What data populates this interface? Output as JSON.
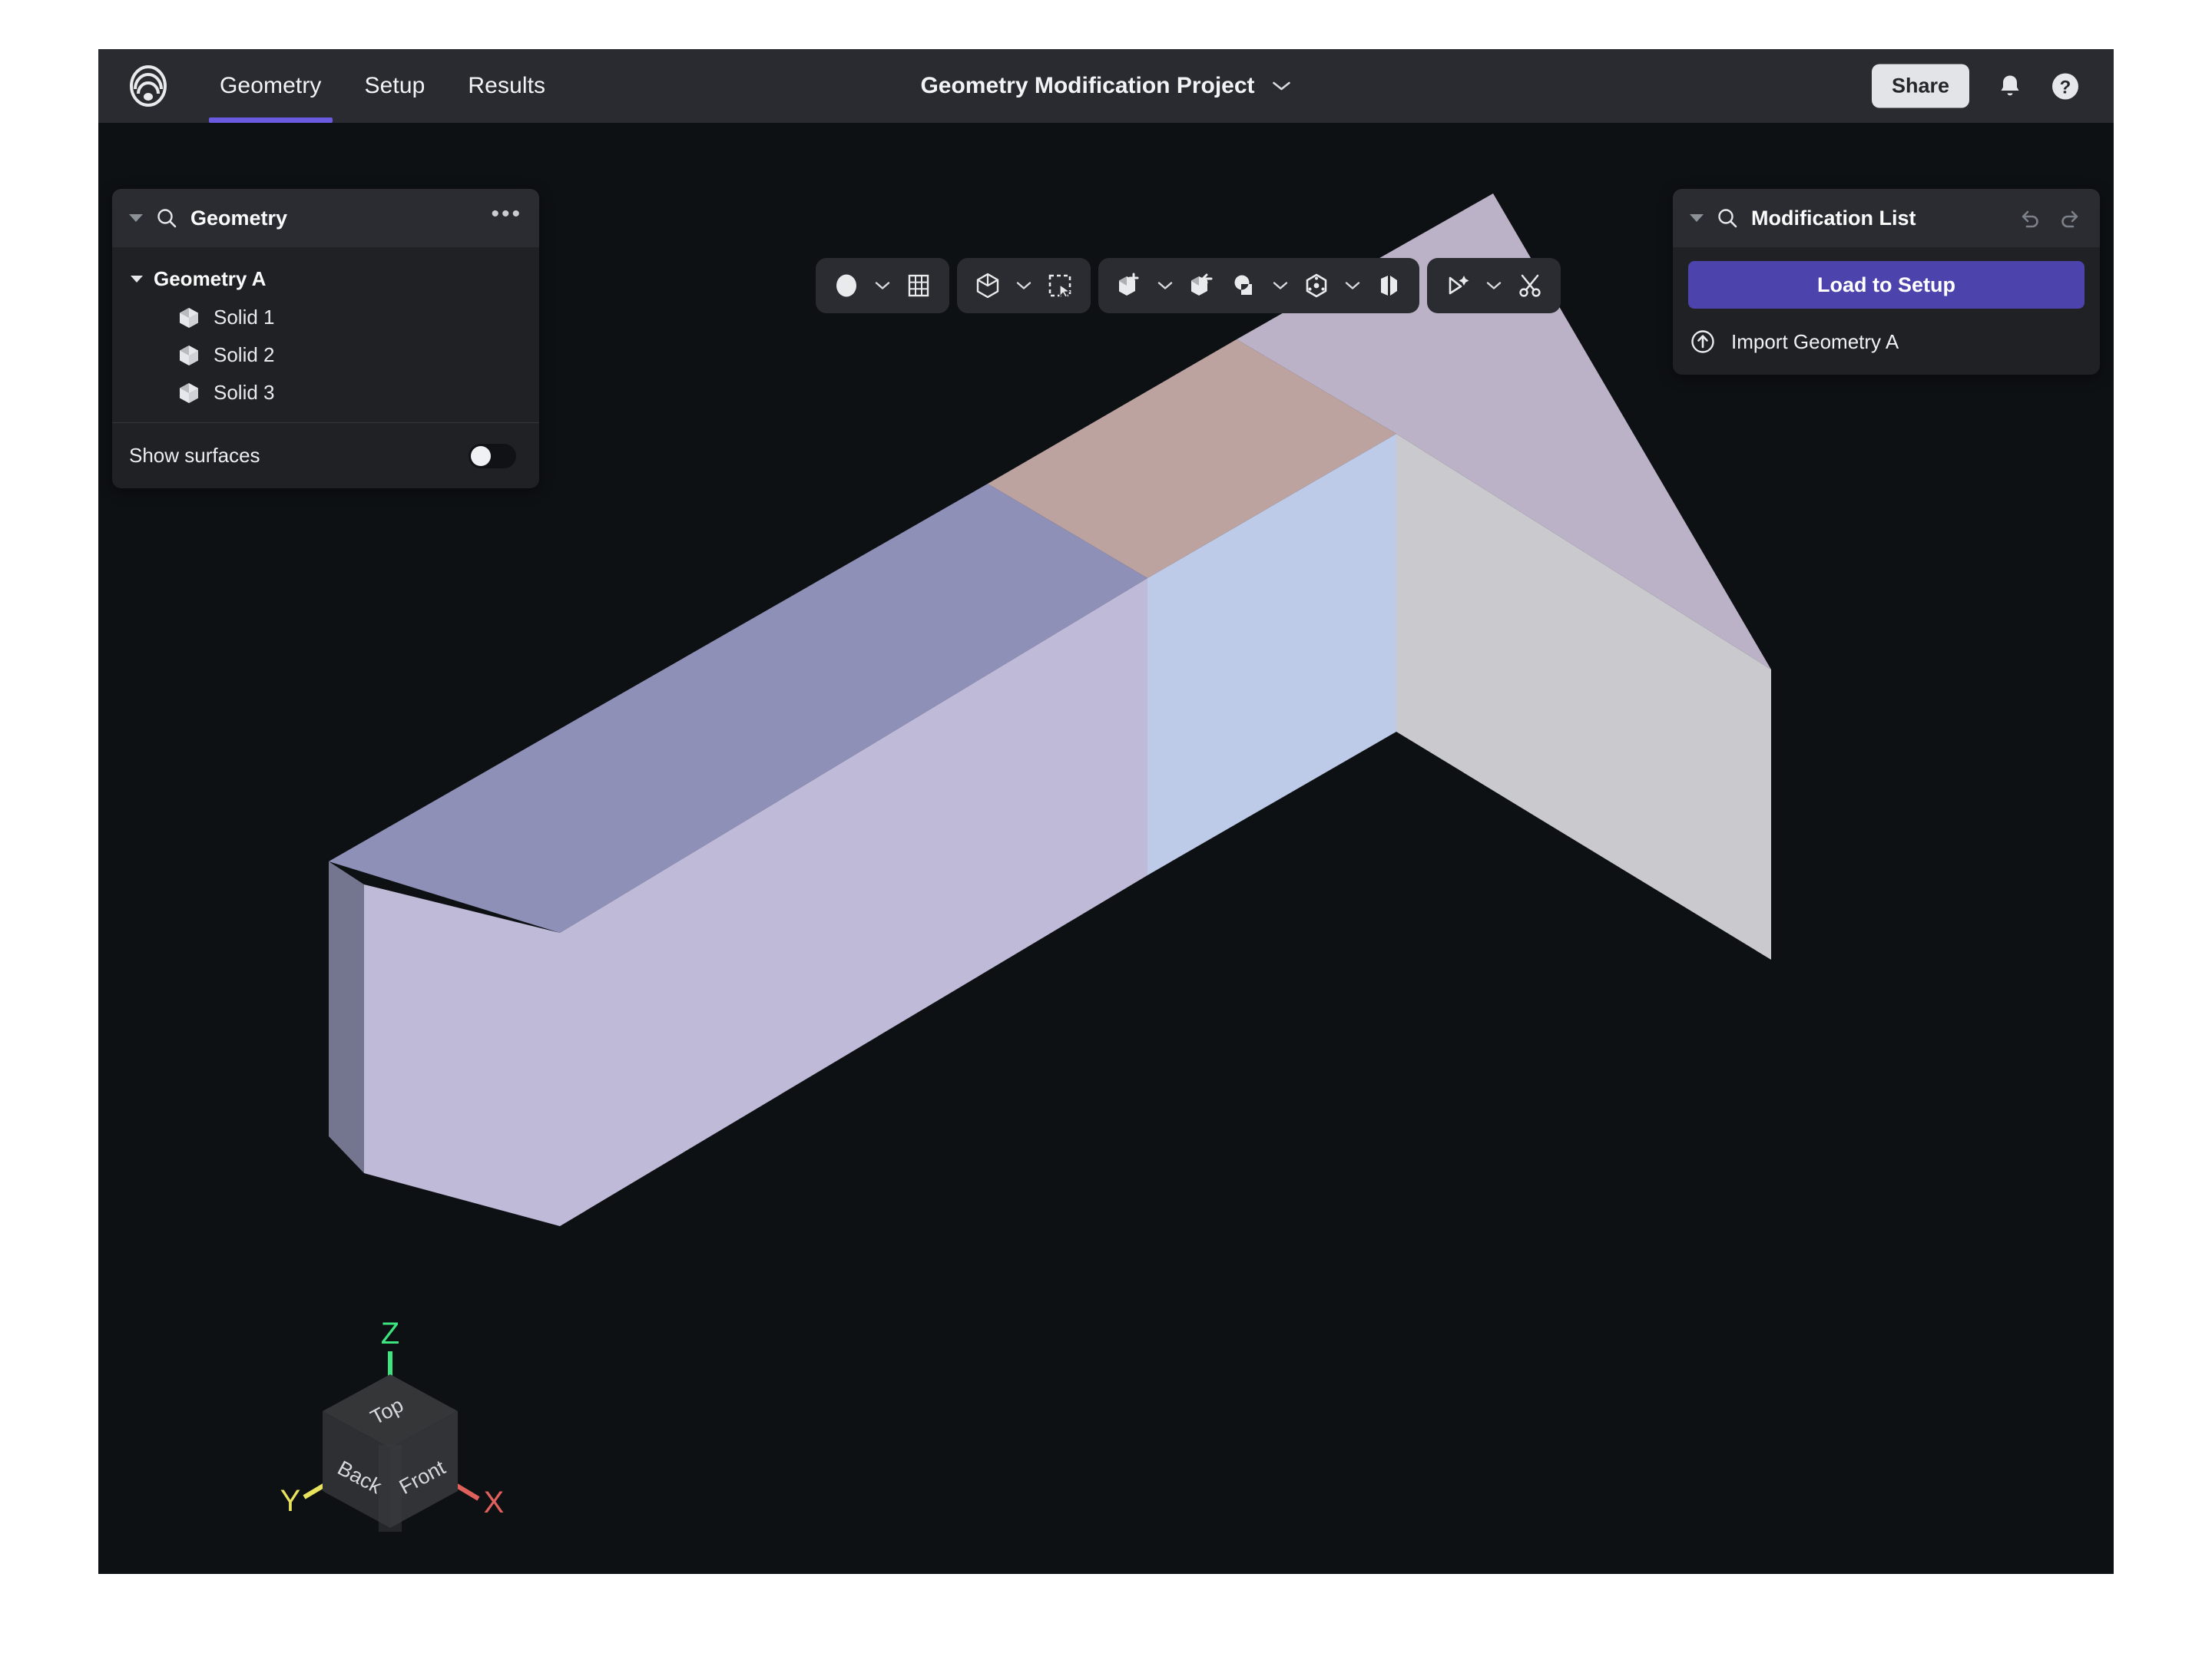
{
  "header": {
    "logo_icon": "concentric-arcs-logo",
    "tabs": [
      {
        "label": "Geometry",
        "active": true
      },
      {
        "label": "Setup",
        "active": false
      },
      {
        "label": "Results",
        "active": false
      }
    ],
    "project_title": "Geometry Modification Project",
    "title_caret_icon": "chevron-down-icon",
    "share_label": "Share",
    "notifications_icon": "bell-icon",
    "help_icon": "question-mark-icon"
  },
  "left_panel": {
    "collapse_icon": "triangle-down-icon",
    "search_icon": "search-icon",
    "title": "Geometry",
    "menu_icon": "ellipsis-icon",
    "tree": {
      "root_label": "Geometry A",
      "root_expanded": true,
      "items": [
        {
          "label": "Solid 1",
          "icon": "cube-icon"
        },
        {
          "label": "Solid 2",
          "icon": "cube-icon"
        },
        {
          "label": "Solid 3",
          "icon": "cube-icon"
        }
      ]
    },
    "footer": {
      "label": "Show surfaces",
      "toggle_on": false
    }
  },
  "toolbar": {
    "groups": [
      {
        "name": "display-group",
        "buttons": [
          {
            "icon": "filled-circle-icon",
            "name": "render-mode-button",
            "caret": true
          },
          {
            "icon": "grid-icon",
            "name": "grid-toggle-button",
            "caret": false
          }
        ]
      },
      {
        "name": "selection-group",
        "buttons": [
          {
            "icon": "cube-outline-icon",
            "name": "select-solid-button",
            "caret": true
          },
          {
            "icon": "marquee-select-icon",
            "name": "box-select-button",
            "caret": false
          }
        ]
      },
      {
        "name": "modify-group",
        "buttons": [
          {
            "icon": "cube-plus-icon",
            "name": "add-solid-button",
            "caret": true
          },
          {
            "icon": "cube-minus-icon",
            "name": "subtract-solid-button",
            "caret": false
          },
          {
            "icon": "boolean-intersect-icon",
            "name": "boolean-button",
            "caret": true
          },
          {
            "icon": "hexagon-origin-icon",
            "name": "transform-button",
            "caret": true
          },
          {
            "icon": "mirror-fold-icon",
            "name": "mirror-button",
            "caret": false
          }
        ]
      },
      {
        "name": "tools-group",
        "buttons": [
          {
            "icon": "magic-wand-icon",
            "name": "auto-detect-button",
            "caret": true
          },
          {
            "icon": "scissors-icon",
            "name": "cut-button",
            "caret": false
          }
        ]
      }
    ]
  },
  "right_panel": {
    "collapse_icon": "triangle-down-icon",
    "search_icon": "search-icon",
    "title": "Modification List",
    "undo_icon": "undo-arrow-icon",
    "redo_icon": "redo-arrow-icon",
    "primary_button_label": "Load to Setup",
    "primary_button_color": "#4c43ac",
    "items": [
      {
        "label": "Import Geometry A",
        "icon": "upload-circle-icon"
      }
    ]
  },
  "viewport": {
    "background": "#0e1114",
    "cursor_icon": "pointing-hand-cursor",
    "view_cube": {
      "faces": [
        "Top",
        "Back",
        "Front"
      ],
      "axes": [
        {
          "label": "Z",
          "color": "#3ce57f"
        },
        {
          "label": "Y",
          "color": "#e8e25c"
        },
        {
          "label": "X",
          "color": "#e0615c"
        }
      ]
    },
    "model": {
      "name": "three-segment-box",
      "segments": [
        {
          "name": "Solid 1",
          "top_color": "#8f90b8",
          "front_color": "#bebad8",
          "end_color": "#74758f"
        },
        {
          "name": "Solid 2",
          "top_color": "#bda3a0",
          "front_color": "#bdcbe8"
        },
        {
          "name": "Solid 3",
          "top_color": "#bbb2c7",
          "front_color": "#c9c9ce",
          "end_color": "#c9c9ce"
        }
      ]
    }
  }
}
